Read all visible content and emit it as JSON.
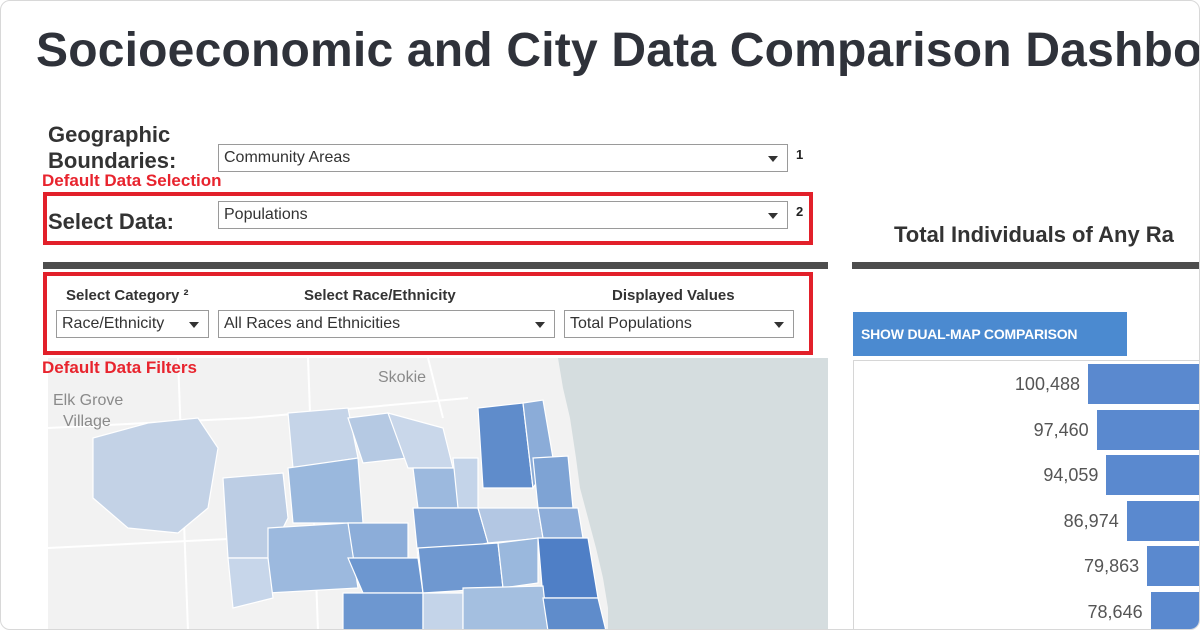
{
  "header": {
    "title": "Socioeconomic and City Data Comparison Dashboard"
  },
  "controls": {
    "geo_label_line1": "Geographic",
    "geo_label_line2": "Boundaries:",
    "geo_value": "Community Areas",
    "geo_footnote": "1",
    "data_label": "Select Data:",
    "data_value": "Populations",
    "data_footnote": "2"
  },
  "annotations": {
    "default_selection": "Default Data Selection",
    "default_filters": "Default Data Filters"
  },
  "filters": {
    "category_label": "Select Category ²",
    "category_value": "Race/Ethnicity",
    "race_label": "Select Race/Ethnicity",
    "race_value": "All Races and Ethnicities",
    "values_label": "Displayed Values",
    "values_value": "Total Populations"
  },
  "map": {
    "labels": [
      "Skokie",
      "Elk Grove",
      "Village"
    ],
    "lake_color": "#d5dddf",
    "land_color": "#efefef"
  },
  "chart": {
    "title": "Total  Individuals of Any Ra",
    "dual_map_button": "SHOW DUAL-MAP COMPARISON",
    "bar_color": "#5a89cf"
  },
  "chart_data": {
    "type": "bar",
    "orientation": "horizontal",
    "title": "Total  Individuals of Any Ra",
    "values": [
      100488,
      97460,
      94059,
      86974,
      79863,
      78646
    ],
    "value_labels": [
      "100,488",
      "97,460",
      "94,059",
      "86,974",
      "79,863",
      "78,646"
    ]
  }
}
